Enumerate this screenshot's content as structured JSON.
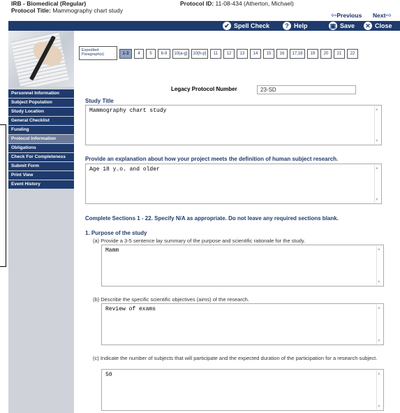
{
  "header": {
    "board": "IRB - Biomedical (Regular)",
    "protocol_title_label": "Protocol Title:",
    "protocol_title": "Mammography chart study",
    "protocol_id_label": "Protocol ID:",
    "protocol_id": "11-08-434 (Atherton, Michael)",
    "previous": "Previous",
    "next": "Next"
  },
  "toolbar": {
    "spell_check": "Spell Check",
    "help": "Help",
    "save": "Save",
    "close": "Close"
  },
  "sidebar": {
    "items": [
      {
        "label": "Personnel Information",
        "active": false
      },
      {
        "label": "Subject Population",
        "active": false
      },
      {
        "label": "Study Location",
        "active": false
      },
      {
        "label": "General Checklist",
        "active": false
      },
      {
        "label": "Funding",
        "active": false
      },
      {
        "label": "Protocol Information",
        "active": true
      },
      {
        "label": "Obligations",
        "active": false
      },
      {
        "label": "Check For Completeness",
        "active": false
      },
      {
        "label": "Submit Form",
        "active": false
      },
      {
        "label": "Print View",
        "active": false
      },
      {
        "label": "Event History",
        "active": false
      }
    ]
  },
  "section_tabs": {
    "expedited": "Expedited Paragraph(s)",
    "tabs": [
      "1-3",
      "4",
      "5",
      "6-9",
      "10(a-g)",
      "10(h-p)",
      "11",
      "12",
      "13",
      "14",
      "15",
      "16",
      "17,18",
      "19",
      "20",
      "21",
      "22"
    ],
    "active_index": 0
  },
  "form": {
    "legacy_label": "Legacy Protocol Number",
    "legacy_value": "23-SD",
    "study_title_label": "Study Title",
    "study_title_value": "Mammography chart study",
    "explanation_label": "Provide an explanation about how your project meets the definition of human subject research.",
    "explanation_value": "Age 18 y.o. and older",
    "instructions": "Complete Sections 1 - 22. Specify N/A as appropriate. Do not leave any required sections blank.",
    "section1_title": "1. Purpose of the study",
    "q_a_label": "(a) Provide a 3-5 sentence lay summary of the purpose and scientific rationale for the study.",
    "q_a_value": "Mamm",
    "q_b_label": "(b) Describe the specific scientific objectives (aims) of the research.",
    "q_b_value": "Review of exams",
    "q_c_label": "(c) Indicate the number of subjects that will participate and the expected duration of the participation for a research subject.",
    "q_c_value": "50"
  }
}
